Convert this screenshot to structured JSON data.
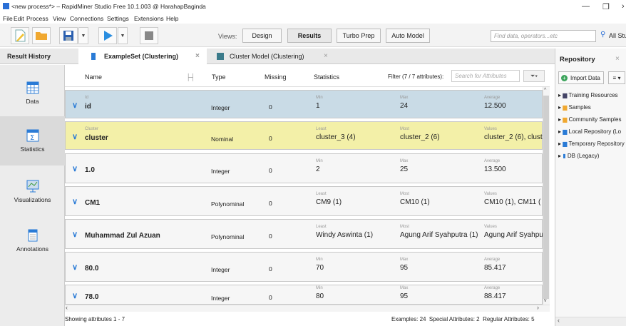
{
  "window": {
    "title": "<new process*> – RapidMiner Studio Free 10.1.003 @ HarahapBaginda"
  },
  "menu": [
    "File",
    "Edit",
    "Process",
    "View",
    "Connections",
    "Settings",
    "Extensions",
    "Help"
  ],
  "toolbar": {
    "views_label": "Views:",
    "views": [
      "Design",
      "Results",
      "Turbo Prep",
      "Auto Model"
    ],
    "active_view": "Results",
    "search_placeholder": "Find data, operators...etc",
    "all_studio": "All Studio"
  },
  "tabs": {
    "result_history": "Result History",
    "exampleset": "ExampleSet (Clustering)",
    "cluster_model": "Cluster Model (Clustering)"
  },
  "sidebar": [
    "Data",
    "Statistics",
    "Visualizations",
    "Annotations"
  ],
  "header": {
    "name": "Name",
    "type": "Type",
    "missing": "Missing",
    "statistics": "Statistics",
    "filter_label": "Filter (7 / 7 attributes):",
    "filter_placeholder": "Search for Attributes"
  },
  "rows": [
    {
      "role": "Id",
      "name": "id",
      "type": "Integer",
      "missing": "0",
      "s1_label": "Min",
      "s1": "1",
      "s2_label": "Max",
      "s2": "24",
      "s3_label": "Average",
      "s3": "12.500",
      "color": "#c9dbe6"
    },
    {
      "role": "Cluster",
      "name": "cluster",
      "type": "Nominal",
      "missing": "0",
      "s1_label": "Least",
      "s1": "cluster_3 (4)",
      "s2_label": "Most",
      "s2": "cluster_2 (6)",
      "s3_label": "Values",
      "s3": "cluster_2 (6), clust",
      "color": "#f3f0a8"
    },
    {
      "role": "",
      "name": "1.0",
      "type": "Integer",
      "missing": "0",
      "s1_label": "Min",
      "s1": "2",
      "s2_label": "Max",
      "s2": "25",
      "s3_label": "Average",
      "s3": "13.500",
      "color": "#f6f6f6"
    },
    {
      "role": "",
      "name": "CM1",
      "type": "Polynominal",
      "missing": "0",
      "s1_label": "Least",
      "s1": "CM9 (1)",
      "s2_label": "Most",
      "s2": "CM10 (1)",
      "s3_label": "Values",
      "s3": "CM10 (1), CM11 (",
      "color": "#f6f6f6"
    },
    {
      "role": "",
      "name": "Muhammad Zul Azuan",
      "type": "Polynominal",
      "missing": "0",
      "s1_label": "Least",
      "s1": "Windy Aswinta (1)",
      "s2_label": "Most",
      "s2": "Agung Arif Syahputra (1)",
      "s3_label": "Values",
      "s3": "Agung Arif Syahput",
      "color": "#f6f6f6"
    },
    {
      "role": "",
      "name": "80.0",
      "type": "Integer",
      "missing": "0",
      "s1_label": "Min",
      "s1": "70",
      "s2_label": "Max",
      "s2": "95",
      "s3_label": "Average",
      "s3": "85.417",
      "color": "#f6f6f6"
    },
    {
      "role": "",
      "name": "78.0",
      "type": "Integer",
      "missing": "0",
      "s1_label": "Min",
      "s1": "80",
      "s2_label": "Max",
      "s2": "95",
      "s3_label": "Average",
      "s3": "88.417",
      "color": "#f6f6f6"
    }
  ],
  "status": {
    "left": "Showing attributes 1 - 7",
    "right": "Examples: 24  Special Attributes: 2  Regular Attributes: 5"
  },
  "repository": {
    "title": "Repository",
    "import_label": "Import Data",
    "items": [
      "Training Resources",
      "Samples",
      "Community Samples",
      "Local Repository (Lo",
      "Temporary Repository",
      "DB (Legacy)"
    ]
  }
}
